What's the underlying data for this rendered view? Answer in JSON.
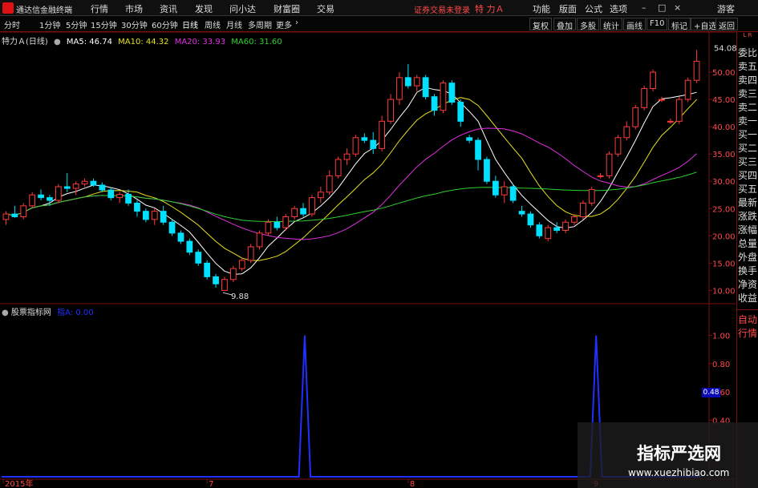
{
  "menubar": {
    "app_title": "通达信金融终端",
    "menus": [
      "行情",
      "市场",
      "资讯",
      "发现",
      "问小达",
      "财富圈",
      "交易"
    ],
    "trade_status": "证券交易未登录",
    "stock_title": "特 力Ａ",
    "right_menus": [
      "功能",
      "版面",
      "公式",
      "选项"
    ],
    "user": "游客"
  },
  "periodbar": {
    "periods": [
      "分时",
      "1分钟",
      "5分钟",
      "15分钟",
      "30分钟",
      "60分钟",
      "日线",
      "周线",
      "月线",
      "多周期",
      "更多"
    ],
    "tools": [
      "复权",
      "叠加",
      "多股",
      "统计",
      "画线",
      "F10",
      "标记",
      "+自选",
      "返回"
    ]
  },
  "legend": {
    "stock": "特力Ａ(日线)",
    "ma5": "MA5: 46.74",
    "ma10": "MA10: 44.32",
    "ma20": "MA20: 33.93",
    "ma60": "MA60: 31.60",
    "ma5_color": "#ffffff",
    "ma10_color": "#e8e020",
    "ma20_color": "#e030e0",
    "ma60_color": "#30d030"
  },
  "indicator": {
    "name": "股票指标网",
    "value_label": "指A: 0.00",
    "price_tag": "0.48"
  },
  "right_panel": {
    "corner": "L R",
    "items": [
      "委比",
      "卖五",
      "卖四",
      "卖三",
      "卖二",
      "卖一",
      "买一",
      "买二",
      "买三",
      "买四",
      "买五",
      "最新",
      "涨跌",
      "涨幅",
      "总量",
      "外盘",
      "换手",
      "净资",
      "收益"
    ],
    "bottom_items": [
      "自动",
      "行情"
    ]
  },
  "watermark": {
    "title": "指标严选网",
    "url": "www.xuezhibiao.com"
  },
  "chart_data": [
    {
      "type": "candlestick",
      "title": "",
      "ylim": [
        8,
        55
      ],
      "y_ticks": [
        10.0,
        15.0,
        20.0,
        25.0,
        30.0,
        35.0,
        40.0,
        45.0,
        50.0
      ],
      "x_ticks": [
        "2015年",
        "7",
        "8",
        "9"
      ],
      "annotations": [
        {
          "text": "54.08",
          "x": 85,
          "y": 54.08
        },
        {
          "text": "9.88",
          "x": 25,
          "y": 9.88
        }
      ],
      "up_color": "#ff3b3b",
      "down_color": "#00e0ff",
      "candles": [
        {
          "o": 23.0,
          "h": 24.5,
          "l": 22.0,
          "c": 24.0
        },
        {
          "o": 24.0,
          "h": 25.5,
          "l": 23.3,
          "c": 23.5
        },
        {
          "o": 23.5,
          "h": 26.0,
          "l": 23.0,
          "c": 25.5
        },
        {
          "o": 25.5,
          "h": 28.0,
          "l": 25.0,
          "c": 27.5
        },
        {
          "o": 27.5,
          "h": 28.5,
          "l": 26.5,
          "c": 27.0
        },
        {
          "o": 27.0,
          "h": 27.5,
          "l": 25.5,
          "c": 26.5
        },
        {
          "o": 26.5,
          "h": 29.5,
          "l": 26.0,
          "c": 29.0
        },
        {
          "o": 29.0,
          "h": 31.5,
          "l": 28.0,
          "c": 28.7
        },
        {
          "o": 28.7,
          "h": 30.0,
          "l": 27.5,
          "c": 29.5
        },
        {
          "o": 29.5,
          "h": 30.5,
          "l": 29.0,
          "c": 30.0
        },
        {
          "o": 30.0,
          "h": 30.5,
          "l": 29.0,
          "c": 29.3
        },
        {
          "o": 29.3,
          "h": 29.8,
          "l": 28.0,
          "c": 28.4
        },
        {
          "o": 28.4,
          "h": 28.8,
          "l": 26.5,
          "c": 27.0
        },
        {
          "o": 27.0,
          "h": 28.0,
          "l": 26.0,
          "c": 27.6
        },
        {
          "o": 27.6,
          "h": 28.5,
          "l": 25.5,
          "c": 26.0
        },
        {
          "o": 26.0,
          "h": 26.5,
          "l": 23.5,
          "c": 24.5
        },
        {
          "o": 24.5,
          "h": 25.0,
          "l": 22.5,
          "c": 23.0
        },
        {
          "o": 23.0,
          "h": 25.0,
          "l": 22.0,
          "c": 24.5
        },
        {
          "o": 24.5,
          "h": 25.5,
          "l": 22.0,
          "c": 22.5
        },
        {
          "o": 22.5,
          "h": 23.0,
          "l": 20.0,
          "c": 20.5
        },
        {
          "o": 20.5,
          "h": 21.0,
          "l": 18.5,
          "c": 19.0
        },
        {
          "o": 19.0,
          "h": 19.5,
          "l": 16.5,
          "c": 17.0
        },
        {
          "o": 17.0,
          "h": 17.5,
          "l": 14.5,
          "c": 15.0
        },
        {
          "o": 15.0,
          "h": 15.5,
          "l": 12.0,
          "c": 12.5
        },
        {
          "o": 12.5,
          "h": 13.0,
          "l": 10.5,
          "c": 11.2
        },
        {
          "o": 10.0,
          "h": 12.5,
          "l": 9.88,
          "c": 12.0
        },
        {
          "o": 12.0,
          "h": 14.5,
          "l": 11.5,
          "c": 14.0
        },
        {
          "o": 14.0,
          "h": 16.0,
          "l": 13.5,
          "c": 15.5
        },
        {
          "o": 15.5,
          "h": 18.5,
          "l": 15.0,
          "c": 18.0
        },
        {
          "o": 18.0,
          "h": 21.0,
          "l": 17.5,
          "c": 20.5
        },
        {
          "o": 20.5,
          "h": 23.0,
          "l": 20.0,
          "c": 22.5
        },
        {
          "o": 22.5,
          "h": 23.5,
          "l": 21.0,
          "c": 21.5
        },
        {
          "o": 21.5,
          "h": 24.0,
          "l": 21.0,
          "c": 23.5
        },
        {
          "o": 23.5,
          "h": 25.5,
          "l": 23.0,
          "c": 25.0
        },
        {
          "o": 25.0,
          "h": 26.0,
          "l": 23.5,
          "c": 24.0
        },
        {
          "o": 24.0,
          "h": 27.5,
          "l": 23.5,
          "c": 27.0
        },
        {
          "o": 27.0,
          "h": 29.0,
          "l": 26.0,
          "c": 28.0
        },
        {
          "o": 28.0,
          "h": 32.0,
          "l": 27.5,
          "c": 31.0
        },
        {
          "o": 31.0,
          "h": 34.5,
          "l": 30.5,
          "c": 34.0
        },
        {
          "o": 34.0,
          "h": 36.0,
          "l": 33.0,
          "c": 35.0
        },
        {
          "o": 35.0,
          "h": 38.5,
          "l": 34.5,
          "c": 38.0
        },
        {
          "o": 38.0,
          "h": 38.8,
          "l": 37.0,
          "c": 37.5
        },
        {
          "o": 37.5,
          "h": 39.0,
          "l": 35.0,
          "c": 36.0
        },
        {
          "o": 36.0,
          "h": 42.0,
          "l": 35.5,
          "c": 41.0
        },
        {
          "o": 41.0,
          "h": 46.0,
          "l": 40.5,
          "c": 45.0
        },
        {
          "o": 45.0,
          "h": 50.0,
          "l": 44.0,
          "c": 49.0
        },
        {
          "o": 49.0,
          "h": 51.5,
          "l": 47.0,
          "c": 47.5
        },
        {
          "o": 47.5,
          "h": 49.5,
          "l": 46.5,
          "c": 49.0
        },
        {
          "o": 49.0,
          "h": 49.5,
          "l": 45.0,
          "c": 45.5
        },
        {
          "o": 45.5,
          "h": 46.0,
          "l": 42.0,
          "c": 43.0
        },
        {
          "o": 43.0,
          "h": 48.5,
          "l": 42.5,
          "c": 48.0
        },
        {
          "o": 48.0,
          "h": 48.5,
          "l": 44.0,
          "c": 44.5
        },
        {
          "o": 44.5,
          "h": 45.0,
          "l": 40.0,
          "c": 41.0
        },
        {
          "o": 38.0,
          "h": 38.5,
          "l": 37.0,
          "c": 37.5
        },
        {
          "o": 37.5,
          "h": 38.0,
          "l": 32.0,
          "c": 34.0
        },
        {
          "o": 34.0,
          "h": 34.5,
          "l": 29.5,
          "c": 30.0
        },
        {
          "o": 30.0,
          "h": 31.0,
          "l": 27.0,
          "c": 27.5
        },
        {
          "o": 27.5,
          "h": 30.0,
          "l": 26.0,
          "c": 29.0
        },
        {
          "o": 29.0,
          "h": 29.5,
          "l": 26.0,
          "c": 26.5
        },
        {
          "o": 24.5,
          "h": 25.5,
          "l": 23.5,
          "c": 24.0
        },
        {
          "o": 24.0,
          "h": 24.5,
          "l": 21.5,
          "c": 22.0
        },
        {
          "o": 22.0,
          "h": 22.5,
          "l": 19.5,
          "c": 20.0
        },
        {
          "o": 19.5,
          "h": 22.0,
          "l": 19.0,
          "c": 21.5
        },
        {
          "o": 21.5,
          "h": 22.5,
          "l": 20.5,
          "c": 21.0
        },
        {
          "o": 21.0,
          "h": 23.0,
          "l": 20.5,
          "c": 22.5
        },
        {
          "o": 22.5,
          "h": 24.0,
          "l": 22.0,
          "c": 23.5
        },
        {
          "o": 23.5,
          "h": 26.5,
          "l": 23.0,
          "c": 26.0
        },
        {
          "o": 26.0,
          "h": 29.0,
          "l": 25.5,
          "c": 28.5
        },
        {
          "o": 31.0,
          "h": 31.5,
          "l": 30.5,
          "c": 31.0
        },
        {
          "o": 31.0,
          "h": 35.5,
          "l": 30.5,
          "c": 35.0
        },
        {
          "o": 35.0,
          "h": 38.5,
          "l": 34.5,
          "c": 38.0
        },
        {
          "o": 38.0,
          "h": 41.0,
          "l": 37.5,
          "c": 40.0
        },
        {
          "o": 40.0,
          "h": 44.0,
          "l": 39.5,
          "c": 43.5
        },
        {
          "o": 43.5,
          "h": 47.5,
          "l": 43.0,
          "c": 47.0
        },
        {
          "o": 47.0,
          "h": 50.5,
          "l": 46.5,
          "c": 50.0
        },
        {
          "o": 45.0,
          "h": 45.5,
          "l": 44.5,
          "c": 45.0
        },
        {
          "o": 41.0,
          "h": 41.5,
          "l": 40.5,
          "c": 41.0
        },
        {
          "o": 41.0,
          "h": 45.5,
          "l": 40.5,
          "c": 45.0
        },
        {
          "o": 45.0,
          "h": 49.0,
          "l": 44.5,
          "c": 48.5
        },
        {
          "o": 48.5,
          "h": 54.08,
          "l": 48.0,
          "c": 52.0
        }
      ],
      "series": [
        {
          "name": "MA5",
          "color": "#ffffff"
        },
        {
          "name": "MA10",
          "color": "#e8e020"
        },
        {
          "name": "MA20",
          "color": "#e030e0"
        },
        {
          "name": "MA60",
          "color": "#30d030"
        }
      ]
    },
    {
      "type": "line",
      "title": "",
      "ylim": [
        0,
        1.15
      ],
      "y_ticks": [
        0.4,
        0.6,
        0.8,
        1.0
      ],
      "color": "#2030ff",
      "x": [
        0,
        50,
        51,
        52,
        53,
        54,
        55,
        100,
        101,
        102,
        103,
        104,
        105,
        120
      ],
      "values": [
        0,
        0,
        0,
        1.0,
        0,
        0,
        0,
        0,
        0,
        1.0,
        0,
        0,
        0,
        0
      ]
    }
  ]
}
